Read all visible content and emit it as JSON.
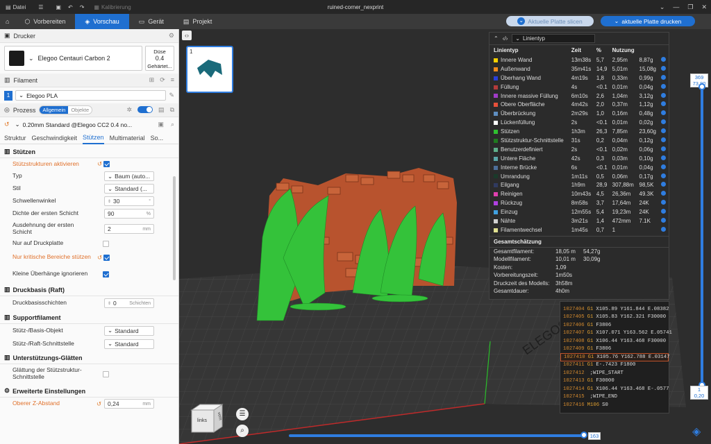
{
  "titlebar": {
    "file_menu": "Datei",
    "calibration": "Kalibrierung",
    "title": "ruined-corner_nexprint"
  },
  "nav": {
    "tabs": [
      {
        "label": "Vorbereiten"
      },
      {
        "label": "Vorschau"
      },
      {
        "label": "Gerät"
      },
      {
        "label": "Projekt"
      }
    ],
    "slice_button": "Aktuelle Platte slicen",
    "print_button": "aktuelle Platte drucken",
    "accent": "#1f6fd0"
  },
  "printer": {
    "header": "Drucker",
    "name": "Elegoo Centauri Carbon 2",
    "nozzle_label": "Düse",
    "nozzle_value": "0.4",
    "nozzle_type": "Gehärtet..."
  },
  "filament": {
    "header": "Filament",
    "index": "1",
    "name": "Elegoo PLA"
  },
  "process": {
    "header": "Prozess",
    "toggle_general": "Allgemein",
    "toggle_objects": "Objekte",
    "profile": "0.20mm Standard @Elegoo CC2 0.4 no...",
    "tabs": [
      "Struktur",
      "Geschwindigkeit",
      "Stützen",
      "Multimaterial",
      "So..."
    ]
  },
  "settings": {
    "g_support": "Stützen",
    "enable_support": "Stützstrukturen aktivieren",
    "type_label": "Typ",
    "type_value": "Baum (auto...",
    "style_label": "Stil",
    "style_value": "Standard (...",
    "threshold_label": "Schwellenwinkel",
    "threshold_value": "30",
    "threshold_unit": "°",
    "first_density_label": "Dichte der ersten Schicht",
    "first_density_value": "90",
    "first_density_unit": "%",
    "first_expand_label": "Ausdehnung der ersten Schicht",
    "first_expand_value": "2",
    "first_expand_unit": "mm",
    "buildplate_only_label": "Nur auf Druckplatte",
    "critical_label": "Nur kritische Bereiche stützen",
    "ignore_small_label": "Kleine Überhänge ignorieren",
    "g_raft": "Druckbasis (Raft)",
    "raft_layers_label": "Druckbasisschichten",
    "raft_layers_value": "0",
    "raft_layers_unit": "Schichten",
    "g_filament": "Supportfilament",
    "base_obj_label": "Stütz-/Basis-Objekt",
    "base_obj_value": "Standard",
    "raft_iface_label": "Stütz-/Raft-Schnittstelle",
    "raft_iface_value": "Standard",
    "g_ironing": "Unterstützungs-Glätten",
    "iron_label": "Glättung der Stützstruktur-Schnittstelle",
    "g_advanced": "Erweiterte Einstellungen",
    "top_z_label": "Oberer Z-Abstand",
    "top_z_value": "0,24",
    "top_z_unit": "mm"
  },
  "plate": {
    "number": "1"
  },
  "stats": {
    "dropdown": "Linientyp",
    "headers": [
      "Linientyp",
      "Zeit",
      "%",
      "Nutzung"
    ],
    "rows": [
      {
        "name": "Innere Wand",
        "time": "13m38s",
        "pct": "5,7",
        "len": "2,95m",
        "wt": "8,87g",
        "color": "#f5d000"
      },
      {
        "name": "Außenwand",
        "time": "35m41s",
        "pct": "14,9",
        "len": "5,01m",
        "wt": "15,08g",
        "color": "#f28a1d"
      },
      {
        "name": "Überhang Wand",
        "time": "4m19s",
        "pct": "1,8",
        "len": "0,33m",
        "wt": "0,99g",
        "color": "#2a3fd8"
      },
      {
        "name": "Füllung",
        "time": "4s",
        "pct": "<0.1",
        "len": "0,01m",
        "wt": "0,04g",
        "color": "#b33b3b"
      },
      {
        "name": "Innere massive Füllung",
        "time": "6m10s",
        "pct": "2,6",
        "len": "1,04m",
        "wt": "3,12g",
        "color": "#a03cc8"
      },
      {
        "name": "Obere Oberfläche",
        "time": "4m42s",
        "pct": "2,0",
        "len": "0,37m",
        "wt": "1,12g",
        "color": "#e8503a"
      },
      {
        "name": "Überbrückung",
        "time": "2m29s",
        "pct": "1,0",
        "len": "0,16m",
        "wt": "0,48g",
        "color": "#5f8ec0"
      },
      {
        "name": "Lückenfüllung",
        "time": "2s",
        "pct": "<0.1",
        "len": "0,01m",
        "wt": "0,02g",
        "color": "#ffffff"
      },
      {
        "name": "Stützen",
        "time": "1h3m",
        "pct": "26,3",
        "len": "7,85m",
        "wt": "23,60g",
        "color": "#30c030"
      },
      {
        "name": "Stützstruktur-Schnittstelle",
        "time": "31s",
        "pct": "0,2",
        "len": "0,04m",
        "wt": "0,12g",
        "color": "#1f7a1f"
      },
      {
        "name": "Benutzerdefiniert",
        "time": "2s",
        "pct": "<0.1",
        "len": "0,02m",
        "wt": "0,06g",
        "color": "#5fb08a"
      },
      {
        "name": "Untere Fläche",
        "time": "42s",
        "pct": "0,3",
        "len": "0,03m",
        "wt": "0,10g",
        "color": "#5aa6a8"
      },
      {
        "name": "Interne Brücke",
        "time": "6s",
        "pct": "<0.1",
        "len": "0,01m",
        "wt": "0,04g",
        "color": "#4c6e9a"
      },
      {
        "name": "Umrandung",
        "time": "1m11s",
        "pct": "0,5",
        "len": "0,06m",
        "wt": "0,17g",
        "color": "#1a3a2a"
      },
      {
        "name": "Eilgang",
        "time": "1h9m",
        "pct": "28,9",
        "len": "307,88m",
        "wt": "98,5K",
        "color": "#303a60"
      },
      {
        "name": "Reinigen",
        "time": "10m43s",
        "pct": "4,5",
        "len": "26,36m",
        "wt": "49.3K",
        "color": "#e040b0"
      },
      {
        "name": "Rückzug",
        "time": "8m58s",
        "pct": "3,7",
        "len": "17,64m",
        "wt": "24K",
        "color": "#b040e0"
      },
      {
        "name": "Einzug",
        "time": "12m55s",
        "pct": "5,4",
        "len": "19,23m",
        "wt": "24K",
        "color": "#40a0e0"
      },
      {
        "name": "Nähte",
        "time": "3m21s",
        "pct": "1,4",
        "len": "472mm",
        "wt": "7.1K",
        "color": "#d0d0d0"
      },
      {
        "name": "Filamentwechsel",
        "time": "1m45s",
        "pct": "0,7",
        "len": "1",
        "wt": "",
        "color": "#e0e090"
      }
    ],
    "estimate_header": "Gesamtschätzung",
    "estimates": [
      {
        "k": "Gesamtfilament:",
        "v": "18,05 m",
        "v2": "54,27g"
      },
      {
        "k": "Modellfilament:",
        "v": "10,01 m",
        "v2": "30,09g"
      },
      {
        "k": "Kosten:",
        "v": "1,09",
        "v2": ""
      },
      {
        "k": "Vorbereitungszeit:",
        "v": "1m50s",
        "v2": ""
      },
      {
        "k": "Druckzeit des Modells:",
        "v": "3h58m",
        "v2": ""
      },
      {
        "k": "Gesamtdauer:",
        "v": "4h0m",
        "v2": ""
      }
    ]
  },
  "gcode": [
    {
      "n": "1027404",
      "c": "G1",
      "a": "X105.89 Y161.844 E.08382"
    },
    {
      "n": "1027405",
      "c": "G1",
      "a": "X105.83 Y162.321 F30000"
    },
    {
      "n": "1027406",
      "c": "G1",
      "a": "F3806"
    },
    {
      "n": "1027407",
      "c": "G1",
      "a": "X107.071 Y163.562 E.05741"
    },
    {
      "n": "1027408",
      "c": "G1",
      "a": "X106.44 Y163.468 F30000"
    },
    {
      "n": "1027409",
      "c": "G1",
      "a": "F3806"
    },
    {
      "n": "1027410",
      "c": "G1",
      "a": "X105.76 Y162.788 E.03147"
    },
    {
      "n": "1027411",
      "c": "G1",
      "a": "E-.7423 F1800"
    },
    {
      "n": "1027412",
      "c": "",
      "a": ";WIPE_START"
    },
    {
      "n": "1027413",
      "c": "G1",
      "a": "F30000"
    },
    {
      "n": "1027414",
      "c": "G1",
      "a": "X106.44 Y163.468 E-.0577"
    },
    {
      "n": "1027415",
      "c": "",
      "a": ";WIPE_END"
    },
    {
      "n": "1027416",
      "c": "M106",
      "a": "S0"
    }
  ],
  "layer_slider": {
    "top_layer": "369",
    "top_height": "73.80",
    "bottom_layer": "1",
    "bottom_height": "0,20"
  },
  "move_slider": {
    "value": "163"
  },
  "cube": {
    "face_left": "links",
    "face_right": "vorn"
  }
}
